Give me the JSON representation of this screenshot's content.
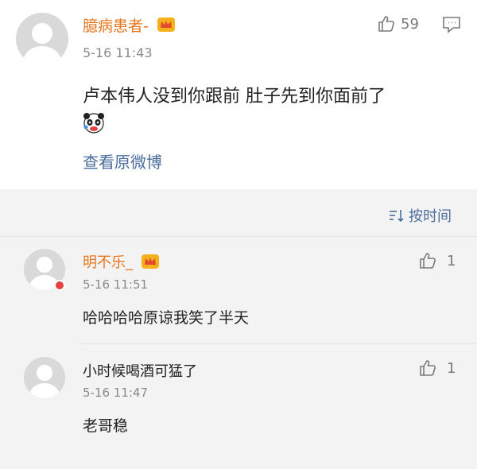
{
  "main_comment": {
    "username": "臆病患者-",
    "time": "5-16 11:43",
    "content": "卢本伟人没到你跟前 肚子先到你面前了",
    "view_original": "查看原微博",
    "like_count": "59",
    "emoji": "panda-emoji"
  },
  "replies_section": {
    "sort_label": "按时间"
  },
  "replies": [
    {
      "username": "明不乐_",
      "time": "5-16 11:51",
      "content": "哈哈哈哈原谅我笑了半天",
      "like_count": "1"
    },
    {
      "username": "小时候喝酒可猛了",
      "time": "5-16 11:47",
      "content": "老哥稳",
      "like_count": "1"
    }
  ],
  "colors": {
    "username": "#e8761f",
    "link": "#4a6d9c",
    "section_bg": "#f3f3f3"
  }
}
